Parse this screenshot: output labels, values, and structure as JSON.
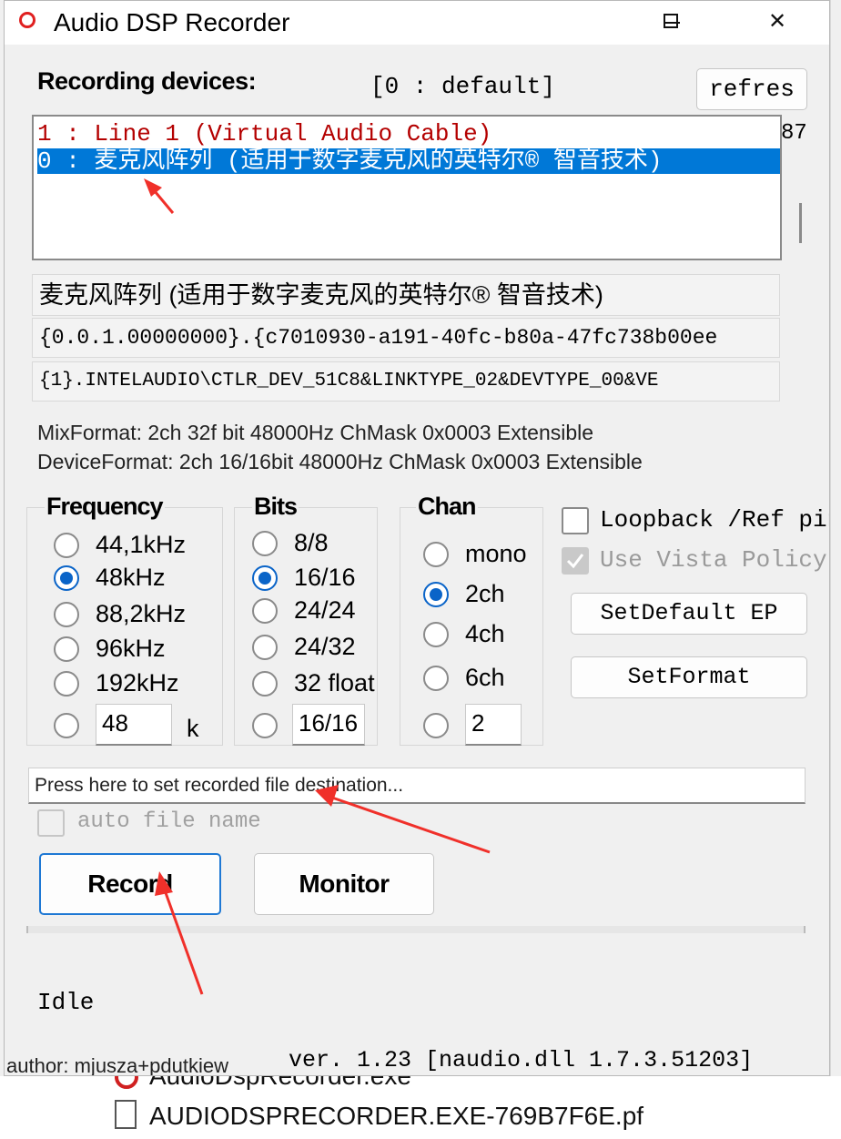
{
  "window": {
    "title": "Audio DSP Recorder",
    "min_glyph": "",
    "close_glyph": "✕"
  },
  "devices": {
    "label": "Recording devices:",
    "selected": "[0 : default]",
    "refresh_label": "refres",
    "side_number": "87",
    "list": [
      {
        "text": "1 : Line 1 (Virtual Audio Cable)",
        "selected": false
      },
      {
        "text": "0 : 麦克风阵列 (适用于数字麦克风的英特尔® 智音技术)",
        "selected": true
      }
    ],
    "name": "麦克风阵列 (适用于数字麦克风的英特尔® 智音技术)",
    "endpoint_id": "{0.0.1.00000000}.{c7010930-a191-40fc-b80a-47fc738b00ee",
    "device_path": "{1}.INTELAUDIO\\CTLR_DEV_51C8&LINKTYPE_02&DEVTYPE_00&VE",
    "mix_format": "MixFormat: 2ch 32f bit 48000Hz ChMask 0x0003 Extensible",
    "device_format": "DeviceFormat: 2ch 16/16bit 48000Hz ChMask 0x0003 Extensible"
  },
  "frequency": {
    "label": "Frequency",
    "options": [
      "44,1kHz",
      "48kHz",
      "88,2kHz",
      "96kHz",
      "192kHz"
    ],
    "selected": "48kHz",
    "custom_value": "48",
    "unit": "k"
  },
  "bits": {
    "label": "Bits",
    "options": [
      "8/8",
      "16/16",
      "24/24",
      "24/32",
      "32 float"
    ],
    "selected": "16/16",
    "custom_value": "16/16"
  },
  "chan": {
    "label": "Chan",
    "options": [
      "mono",
      "2ch",
      "4ch",
      "6ch"
    ],
    "selected": "2ch",
    "custom_value": "2"
  },
  "options": {
    "loopback_label": "Loopback /Ref pin",
    "loopback_checked": false,
    "vista_label": "Use Vista Policy",
    "vista_checked": true,
    "vista_disabled": true,
    "setdefault_label": "SetDefault EP",
    "setformat_label": "SetFormat"
  },
  "file": {
    "destination_text": "Press here to set recorded file destination...",
    "auto_label": "auto file name"
  },
  "controls": {
    "record_label": "Record",
    "monitor_label": "Monitor"
  },
  "status": {
    "text": "Idle",
    "author": "author: mjusza+pdutkiew",
    "version": "ver. 1.23 [naudio.dll 1.7.3.51203]"
  },
  "background": {
    "file1": "AudioDspRecorder.exe",
    "file2": "AUDIODSPRECORDER.EXE-769B7F6E.pf"
  },
  "colors": {
    "accent": "#0a64c8",
    "selection": "#0078d7",
    "line1_text": "#b40000",
    "annotation": "#f0302a"
  }
}
